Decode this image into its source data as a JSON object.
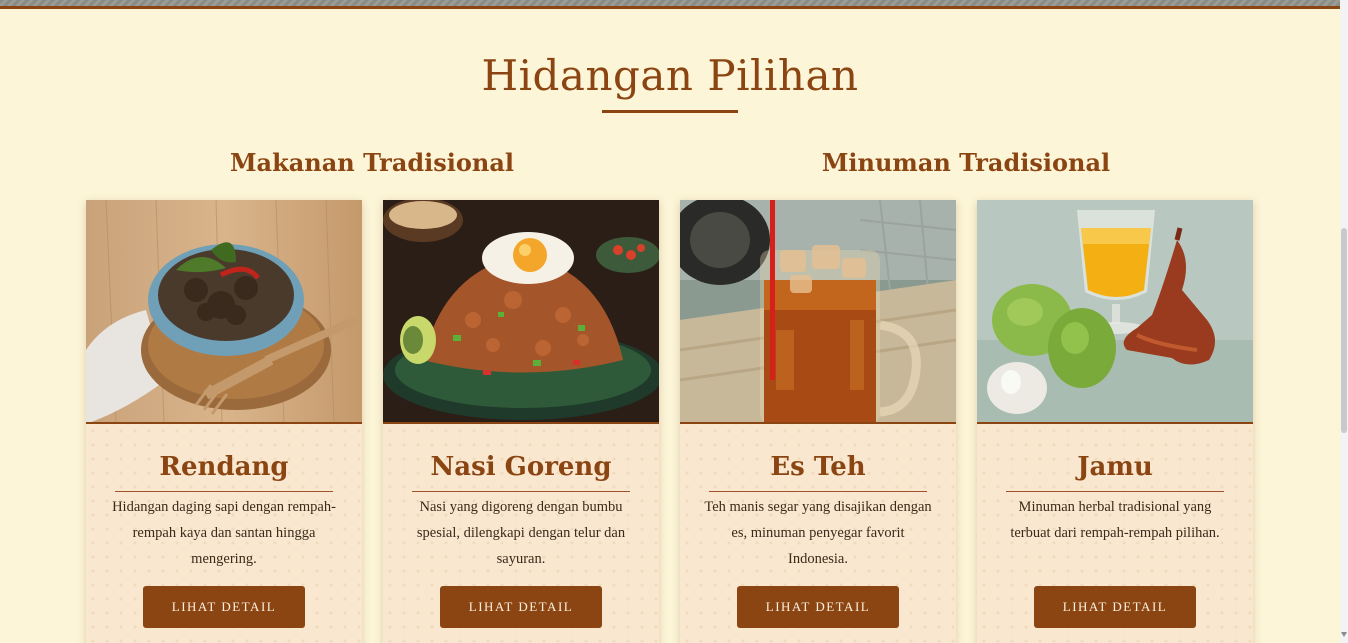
{
  "section": {
    "title": "Hidangan Pilihan"
  },
  "categories": {
    "food": "Makanan Tradisional",
    "drink": "Minuman Tradisional"
  },
  "cards": [
    {
      "name": "Rendang",
      "description": "Hidangan daging sapi dengan rempah-rempah kaya dan santan hingga mengering.",
      "button": "LIHAT DETAIL",
      "image": "rendang-photo"
    },
    {
      "name": "Nasi Goreng",
      "description": "Nasi yang digoreng dengan bumbu spesial, dilengkapi dengan telur dan sayuran.",
      "button": "LIHAT DETAIL",
      "image": "nasi-goreng-photo"
    },
    {
      "name": "Es Teh",
      "description": "Teh manis segar yang disajikan dengan es, minuman penyegar favorit Indonesia.",
      "button": "LIHAT DETAIL",
      "image": "es-teh-photo"
    },
    {
      "name": "Jamu",
      "description": "Minuman herbal tradisional yang terbuat dari rempah-rempah pilihan.",
      "button": "LIHAT DETAIL",
      "image": "jamu-photo"
    }
  ],
  "colors": {
    "background": "#fdf5d8",
    "accent": "#8b4513",
    "card_background": "#f9e8cf",
    "button_text": "#fdf0dc"
  }
}
